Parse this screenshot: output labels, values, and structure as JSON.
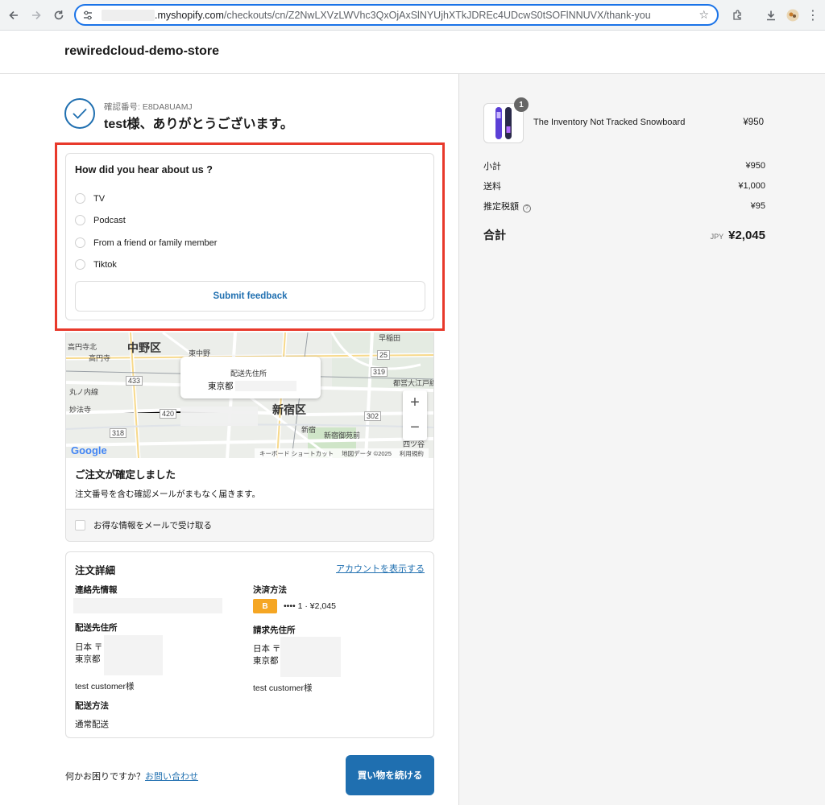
{
  "browser": {
    "url_domain": ".myshopify.com",
    "url_path": "/checkouts/cn/Z2NwLXVzLWVhc3QxOjAxSlNYUjhXTkJDREc4UDcwS0tSOFlNNUVX/thank-you"
  },
  "store": {
    "name": "rewiredcloud-demo-store"
  },
  "confirmation": {
    "number_label": "確認番号: E8DA8UAMJ",
    "thanks": "test様、ありがとうございます。"
  },
  "survey": {
    "question": "How did you hear about us ?",
    "options": [
      "TV",
      "Podcast",
      "From a friend or family member",
      "Tiktok"
    ],
    "submit_label": "Submit feedback"
  },
  "map": {
    "tooltip_title": "配送先住所",
    "tooltip_city": "東京都",
    "labels": {
      "nakano": "中野区",
      "shinjuku": "新宿区",
      "koenji": "高円寺北",
      "koenji_st": "高円寺",
      "higashi": "東中野",
      "marunouchi": "丸ノ内線",
      "myohoji": "妙法寺",
      "shinjuku_st": "新宿",
      "gyoen": "新宿御苑前",
      "yotsuya": "四ツ谷",
      "waseda": "早稲田",
      "toei": "都営大江戸線",
      "r433": "433",
      "r420": "420",
      "r318": "318",
      "r319": "319",
      "r302": "302",
      "r25": "25"
    },
    "zoom_in": "+",
    "zoom_out": "−",
    "google": "Google",
    "shortcuts": "キーボード ショートカット",
    "mapdata": "地図データ ©2025",
    "terms": "利用規約"
  },
  "order_confirmed": {
    "title": "ご注文が確定しました",
    "body": "注文番号を含む確認メールがまもなく届きます。",
    "optin": "お得な情報をメールで受け取る"
  },
  "details": {
    "title": "注文詳細",
    "account_link": "アカウントを表示する",
    "contact_label": "連絡先情報",
    "payment_label": "決済方法",
    "payment_badge": "B",
    "payment_value": "•••• 1 · ¥2,045",
    "shipping_addr_label": "配送先住所",
    "shipping_addr_line1": "日本 〒",
    "shipping_addr_line2": "東京都",
    "shipping_addr_name": "test customer様",
    "billing_addr_label": "請求先住所",
    "billing_addr_line1": "日本 〒",
    "billing_addr_line2": "東京都",
    "billing_addr_name": "test customer様",
    "shipping_method_label": "配送方法",
    "shipping_method_value": "通常配送"
  },
  "footer": {
    "help_text": "何かお困りですか？",
    "help_link": "お問い合わせ",
    "continue_label": "買い物を続ける"
  },
  "summary": {
    "product_name": "The Inventory Not Tracked Snowboard",
    "product_qty": "1",
    "product_price": "¥950",
    "subtotal_label": "小計",
    "subtotal_value": "¥950",
    "shipping_label": "送料",
    "shipping_value": "¥1,000",
    "tax_label": "推定税額",
    "tax_value": "¥95",
    "total_label": "合計",
    "currency": "JPY",
    "total_value": "¥2,045"
  },
  "colors": {
    "accent": "#1f6fb0",
    "highlight": "#e8392b",
    "payment_badge": "#f5a623",
    "summary_bg": "#f5f5f5"
  }
}
